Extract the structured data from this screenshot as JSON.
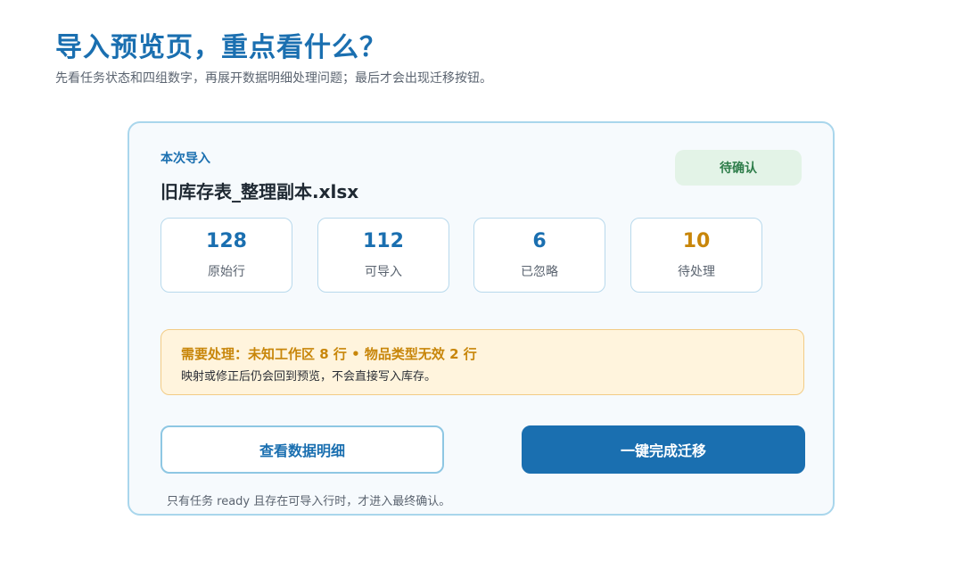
{
  "page": {
    "title": "导入预览页，重点看什么？",
    "subtitle": "先看任务状态和四组数字，再展开数据明细处理问题；最后才会出现迁移按钮。"
  },
  "card": {
    "section_label": "本次导入",
    "file_name": "旧库存表_整理副本.xlsx",
    "status_badge": "待确认",
    "stats": [
      {
        "value": "128",
        "label": "原始行"
      },
      {
        "value": "112",
        "label": "可导入"
      },
      {
        "value": "6",
        "label": "已忽略"
      },
      {
        "value": "10",
        "label": "待处理"
      }
    ],
    "alert": {
      "title": "需要处理：未知工作区 8 行 • 物品类型无效 2 行",
      "text": "映射或修正后仍会回到预览，不会直接写入库存。"
    },
    "buttons": {
      "view_details": "查看数据明细",
      "complete_migration": "一键完成迁移"
    },
    "footnote": "只有任务 ready 且存在可导入行时，才进入最终确认。"
  },
  "colors": {
    "accent": "#1a6fb0",
    "warning": "#c8860a",
    "success": "#2e7d4a",
    "card_border": "#a9d6ec"
  }
}
